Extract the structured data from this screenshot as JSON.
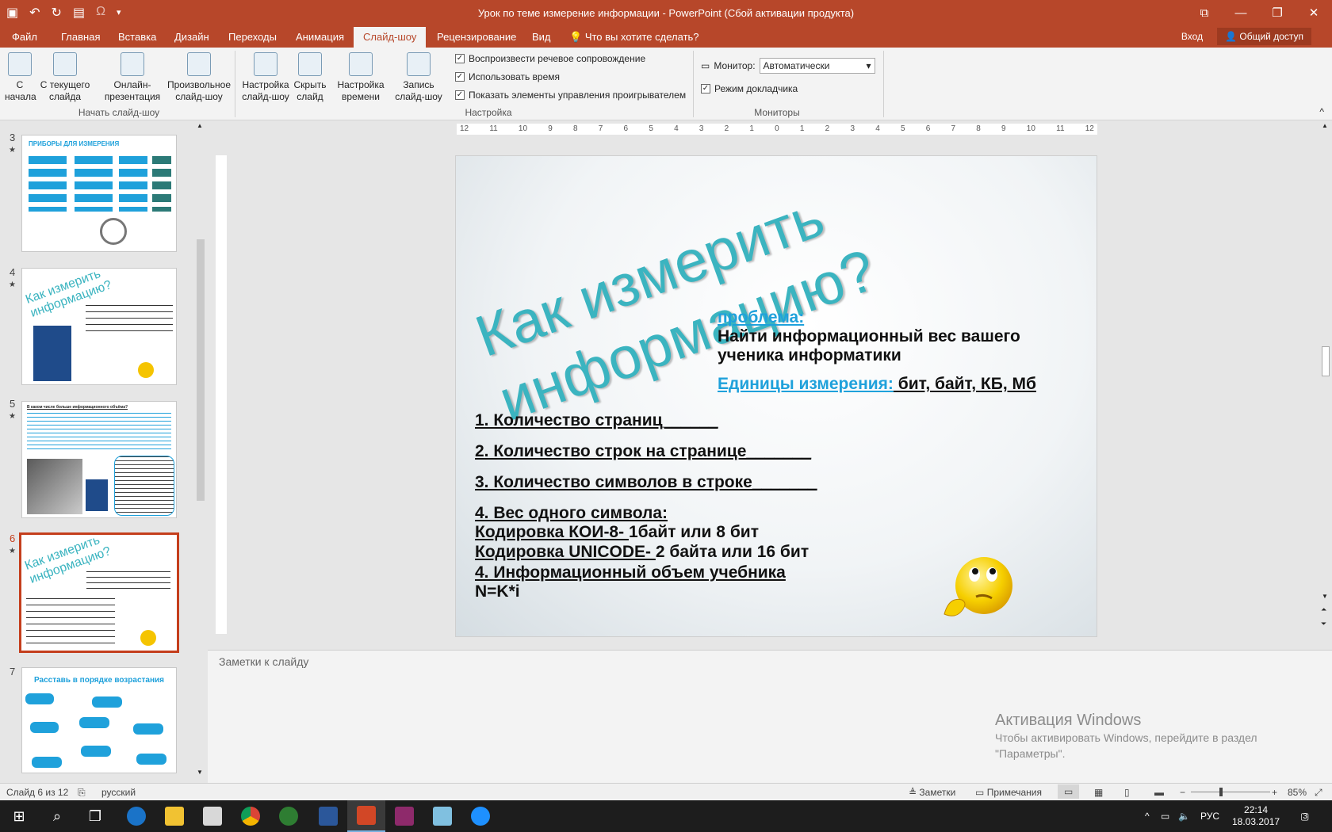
{
  "window": {
    "title": "Урок по теме измерение информации - PowerPoint (Сбой активации продукта)"
  },
  "tabs": [
    {
      "label": "Файл"
    },
    {
      "label": "Главная"
    },
    {
      "label": "Вставка"
    },
    {
      "label": "Дизайн"
    },
    {
      "label": "Переходы"
    },
    {
      "label": "Анимация"
    },
    {
      "label": "Слайд-шоу"
    },
    {
      "label": "Рецензирование"
    },
    {
      "label": "Вид"
    }
  ],
  "tell_me": "Что вы хотите сделать?",
  "signin": "Вход",
  "share": "Общий доступ",
  "ribbon": {
    "from_start": "С начала",
    "from_current": "С текущего слайда",
    "online": "Онлайн-презентация",
    "custom": "Произвольное слайд-шоу",
    "group1_label": "Начать слайд-шоу",
    "setup": "Настройка слайд-шоу",
    "hide": "Скрыть слайд",
    "rehearse": "Настройка времени",
    "record": "Запись слайд-шоу",
    "play_narration": "Воспроизвести речевое сопровождение",
    "use_timings": "Использовать время",
    "show_controls": "Показать элементы управления проигрывателем",
    "group2_label": "Настройка",
    "monitor_label": "Монитор:",
    "monitor_value": "Автоматически",
    "presenter_view": "Режим докладчика",
    "group3_label": "Мониторы"
  },
  "thumbnails": [
    {
      "num": "3",
      "title": "ПРИБОРЫ ДЛЯ ИЗМЕРЕНИЯ"
    },
    {
      "num": "4",
      "title": "Как измерить информацию?"
    },
    {
      "num": "5",
      "title": "В каком числе больше информационного объёма?"
    },
    {
      "num": "6",
      "title": "Как измерить информацию?"
    },
    {
      "num": "7",
      "title": "Расставь в порядке возрастания"
    }
  ],
  "slide": {
    "title_line1": "Как измерить",
    "title_line2": "информацию?",
    "problem_label": "проблема:",
    "problem_text1": "Найти информационный вес вашего",
    "problem_text2": "ученика информатики",
    "units_label": "Единицы измерения:",
    "units_value": " бит, байт, КБ, Мб",
    "item1": "1. Количество страниц______",
    "item2": "2. Количество строк на странице_______",
    "item3": "3. Количество символов в строке_______",
    "item4": "4. Вес одного символа:",
    "koi_label": "Кодировка КОИ-8- ",
    "koi_value": "1байт или 8 бит",
    "uni_label": "Кодировка UNICODE- ",
    "uni_value": "2 байта или 16 бит",
    "item5": "4. Информационный объем учебника",
    "formula": "N=K*i"
  },
  "ruler_ticks": [
    "12",
    "11",
    "10",
    "9",
    "8",
    "7",
    "6",
    "5",
    "4",
    "3",
    "2",
    "1",
    "0",
    "1",
    "2",
    "3",
    "4",
    "5",
    "6",
    "7",
    "8",
    "9",
    "10",
    "11",
    "12"
  ],
  "notes_placeholder": "Заметки к слайду",
  "activation": {
    "heading": "Активация Windows",
    "line1": "Чтобы активировать Windows, перейдите в раздел",
    "line2": "\"Параметры\"."
  },
  "status": {
    "slide_info": "Слайд 6 из 12",
    "language": "русский",
    "notes": "Заметки",
    "comments": "Примечания",
    "zoom": "85%"
  },
  "taskbar": {
    "lang": "РУС",
    "time": "22:14",
    "date": "18.03.2017",
    "notif": "3"
  },
  "colors": {
    "accent": "#b7472a",
    "slide_title": "#3bb4c0",
    "slide_link": "#1fa1db"
  }
}
